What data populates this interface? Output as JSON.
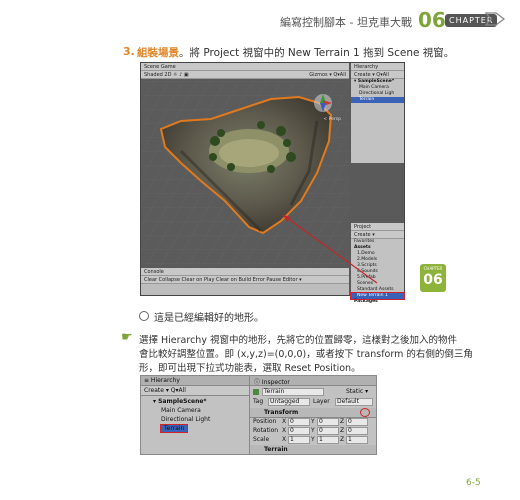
{
  "header": {
    "title": "編寫控制腳本 - 坦克車大戰",
    "chapter_number": "06",
    "chapter_label": "CHAPTER"
  },
  "step": {
    "number": "3.",
    "bold": "組裝場景",
    "text": "。將 Project 視窗中的 New Terrain 1 拖到 Scene 視窗。"
  },
  "editor1": {
    "scene_tabs": "Scene  Game",
    "scene_toolbar": "Shaded   2D  ☼  ♪  ▣",
    "gizmos": "Gizmos ▾  Q▾All",
    "persp": "< Persp",
    "hierarchy": {
      "title": "Hierarchy",
      "create": "Create ▾  Q▾All",
      "items": [
        "▾ SampleScene*",
        "Main Camera",
        "Directional Ligh",
        "Terrain"
      ]
    },
    "project": {
      "title": "Project",
      "create": "Create ▾",
      "items": [
        "Favorites",
        "Assets",
        "1.Demo",
        "2.Models",
        "3.Scripts",
        "4.Sounds",
        "5.Prefab",
        "Scenes",
        "Standard Assets",
        "New Terrain 1",
        "Packages"
      ]
    },
    "console_tabs": "Console",
    "console_toolbar": "Clear  Collapse  Clear on Play  Clear on Build  Error Pause  Editor ▾"
  },
  "chapter_badge": {
    "small": "CHAPTER",
    "number": "06"
  },
  "caption": "這是已經編輯好的地形。",
  "note": {
    "lines": [
      "選擇 Hierarchy 視窗中的地形，先將它的位置歸零，這樣對之後加入的物件",
      "會比較好調整位置。即 (x,y,z)=(0,0,0)，或者按下 transform 的右側的倒三角",
      "形，即可出現下拉式功能表，選取 Reset Position。"
    ]
  },
  "editor2": {
    "hierarchy_title": "≡ Hierarchy",
    "create": "Create ▾  Q▾All",
    "scene": "▾ SampleScene*",
    "items": [
      "Main Camera",
      "Directional Light",
      "Terrain"
    ],
    "inspector_title": "ⓘ Inspector",
    "object_name": "Terrain",
    "static": "Static ▾",
    "tag_label": "Tag",
    "tag_value": "Untagged",
    "layer_label": "Layer",
    "layer_value": "Default",
    "transform_title": "Transform",
    "rows": [
      {
        "label": "Position",
        "x": "0",
        "y": "0",
        "z": "0"
      },
      {
        "label": "Rotation",
        "x": "0",
        "y": "0",
        "z": "0"
      },
      {
        "label": "Scale",
        "x": "1",
        "y": "1",
        "z": "1"
      }
    ],
    "terrain_component": "Terrain",
    "axis_x": "X",
    "axis_y": "Y",
    "axis_z": "Z"
  },
  "page_number": "6-5",
  "colors": {
    "accent_green": "#7fa43a",
    "accent_orange": "#e0862a",
    "unity_select": "#3a63b8",
    "highlight_red": "#d0232a"
  }
}
